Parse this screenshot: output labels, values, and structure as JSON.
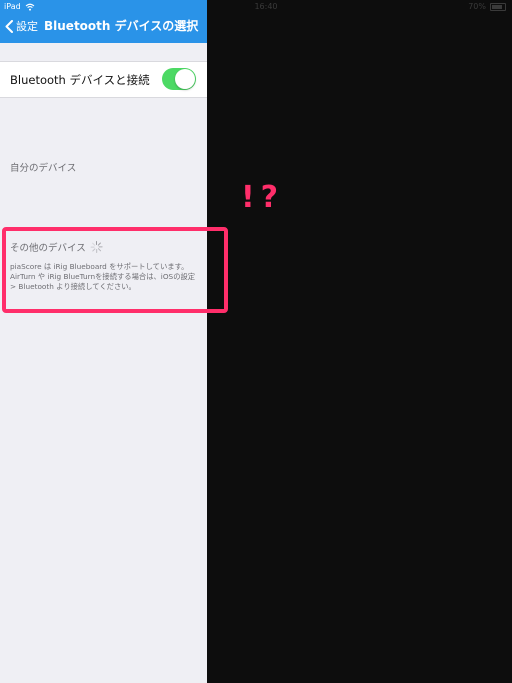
{
  "status_bar": {
    "device": "iPad",
    "time": "16:40",
    "battery": "70%"
  },
  "nav": {
    "back_label": "設定",
    "title": "Bluetooth デバイスの選択"
  },
  "bluetooth_toggle": {
    "label": "Bluetooth デバイスと接続",
    "state": "on"
  },
  "sections": {
    "my_devices": "自分のデバイス",
    "other_devices": "その他のデバイス",
    "note_lines": [
      "piaScore は iRig Blueboard をサポートしています。",
      "AirTurn や iRig BlueTurnを接続する場合は、iOSの設定",
      "> Bluetooth より接続してください。"
    ]
  },
  "annotation": {
    "reaction": "!?",
    "color": "#ff2e6a"
  },
  "colors": {
    "nav": "#2a93e8",
    "toggle_on": "#4cd964",
    "background": "#efeff4",
    "dim_area": "#0d0d0d"
  }
}
